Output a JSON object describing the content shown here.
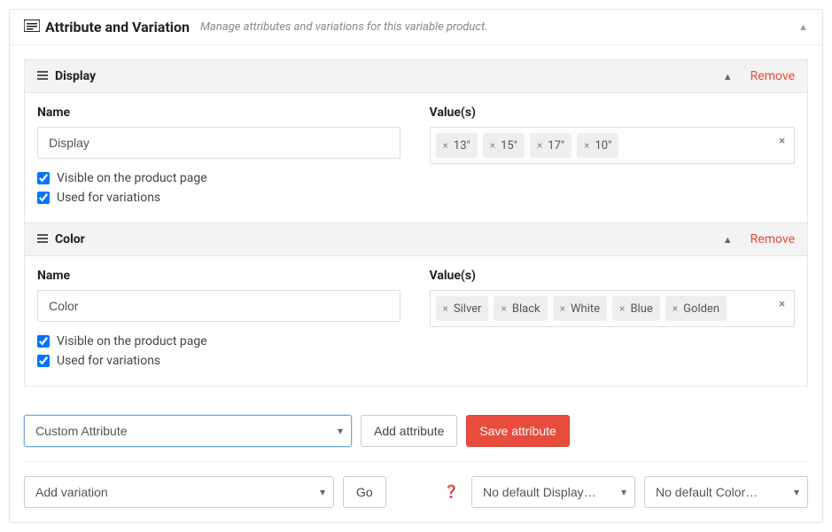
{
  "panel": {
    "title": "Attribute and Variation",
    "subtitle": "Manage attributes and variations for this variable product."
  },
  "attributes": [
    {
      "header": "Display",
      "remove": "Remove",
      "nameLabel": "Name",
      "nameValue": "Display",
      "valuesLabel": "Value(s)",
      "values": [
        "13\"",
        "15\"",
        "17\"",
        "10\""
      ],
      "visibleLabel": "Visible on the product page",
      "visibleChecked": true,
      "usedLabel": "Used for variations",
      "usedChecked": true
    },
    {
      "header": "Color",
      "remove": "Remove",
      "nameLabel": "Name",
      "nameValue": "Color",
      "valuesLabel": "Value(s)",
      "values": [
        "Silver",
        "Black",
        "White",
        "Blue",
        "Golden"
      ],
      "visibleLabel": "Visible on the product page",
      "visibleChecked": true,
      "usedLabel": "Used for variations",
      "usedChecked": true
    }
  ],
  "attributeSelect": "Custom Attribute",
  "addAttributeBtn": "Add attribute",
  "saveAttributeBtn": "Save attribute",
  "variationSelect": "Add variation",
  "goBtn": "Go",
  "defaultDisplay": "No default Display…",
  "defaultColor": "No default Color…"
}
